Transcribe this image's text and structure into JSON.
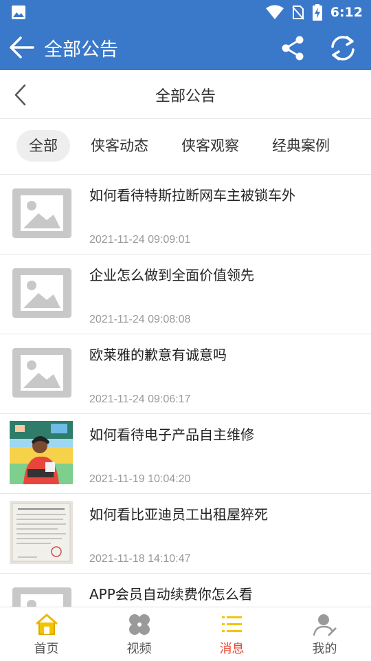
{
  "status_bar": {
    "time": "6:12"
  },
  "app_bar": {
    "title": "全部公告"
  },
  "sub_header": {
    "title": "全部公告"
  },
  "tabs": [
    {
      "label": "全部",
      "active": true
    },
    {
      "label": "侠客动态",
      "active": false
    },
    {
      "label": "侠客观察",
      "active": false
    },
    {
      "label": "经典案例",
      "active": false
    }
  ],
  "articles": [
    {
      "title": "如何看待特斯拉断网车主被锁车外",
      "date": "2021-11-24 09:09:01",
      "thumb": "placeholder"
    },
    {
      "title": "企业怎么做到全面价值领先",
      "date": "2021-11-24 09:08:08",
      "thumb": "placeholder"
    },
    {
      "title": "欧莱雅的歉意有诚意吗",
      "date": "2021-11-24 09:06:17",
      "thumb": "placeholder"
    },
    {
      "title": "如何看待电子产品自主维修",
      "date": "2021-11-19 10:04:20",
      "thumb": "illustration"
    },
    {
      "title": "如何看比亚迪员工出租屋猝死",
      "date": "2021-11-18 14:10:47",
      "thumb": "document-photo"
    },
    {
      "title": "APP会员自动续费你怎么看",
      "date": "",
      "thumb": "placeholder"
    }
  ],
  "bottom_nav": [
    {
      "label": "首页",
      "icon": "home-icon",
      "active": false
    },
    {
      "label": "视频",
      "icon": "video-icon",
      "active": false
    },
    {
      "label": "消息",
      "icon": "message-list-icon",
      "active": true
    },
    {
      "label": "我的",
      "icon": "profile-icon",
      "active": false
    }
  ],
  "colors": {
    "primary": "#3a78c9",
    "active_nav": "#e8452c",
    "nav_icon_yellow": "#f5c400",
    "date_gray": "#999999"
  }
}
